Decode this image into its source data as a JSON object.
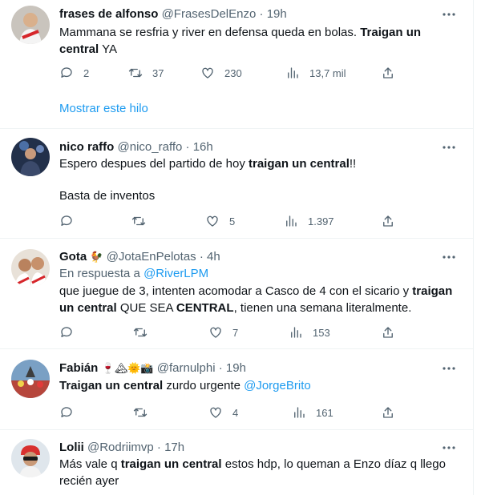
{
  "tweets": [
    {
      "name": "frases de alfonso",
      "handle": "@FrasesDelEnzo",
      "dot": "·",
      "time": "19h",
      "text_parts": [
        "Mammana se resfria y river en defensa queda en bolas. ",
        "Traigan un central",
        " YA"
      ],
      "replies": "2",
      "retweets": "37",
      "likes": "230",
      "views": "13,7 mil",
      "thread_link": "Mostrar este hilo"
    },
    {
      "name": "nico raffo",
      "handle": "@nico_raffo",
      "dot": "·",
      "time": "16h",
      "text_line1_parts": [
        "Espero despues del partido de hoy ",
        "traigan un central",
        "!!"
      ],
      "text_line2": "Basta de inventos",
      "replies": "",
      "retweets": "",
      "likes": "5",
      "views": "1.397"
    },
    {
      "name": "Gota",
      "name_emoji": "🐓",
      "handle": "@JotaEnPelotas",
      "dot": "·",
      "time": "4h",
      "reply_prefix": "En respuesta a ",
      "reply_to": "@RiverLPM",
      "text_parts": [
        "que juegue de 3, intenten acomodar a Casco de 4 con el sicario y ",
        "traigan un central",
        " QUE SEA ",
        "CENTRAL",
        ", tienen una semana literalmente."
      ],
      "replies": "",
      "retweets": "",
      "likes": "7",
      "views": "153"
    },
    {
      "name": "Fabián",
      "name_emoji": "🍷🏔🌞📸",
      "handle": "@farnulphi",
      "dot": "·",
      "time": "19h",
      "text_parts": [
        "Traigan un central",
        " zurdo urgente "
      ],
      "mention": "@JorgeBrito",
      "replies": "",
      "retweets": "",
      "likes": "4",
      "views": "161"
    },
    {
      "name": "Lolii",
      "handle": "@Rodriimvp",
      "dot": "·",
      "time": "17h",
      "text_parts": [
        "Más vale q ",
        "traigan un central",
        " estos hdp, lo queman a Enzo díaz q llego recién ayer"
      ]
    }
  ],
  "icons": {
    "more": "more-horizontal-icon",
    "reply": "reply-icon",
    "retweet": "retweet-icon",
    "like": "heart-icon",
    "views": "views-chart-icon",
    "share": "share-icon"
  },
  "colors": {
    "accent": "#1d9bf0",
    "secondary_text": "#536471",
    "primary_text": "#0f1419",
    "divider": "#eff3f4"
  }
}
